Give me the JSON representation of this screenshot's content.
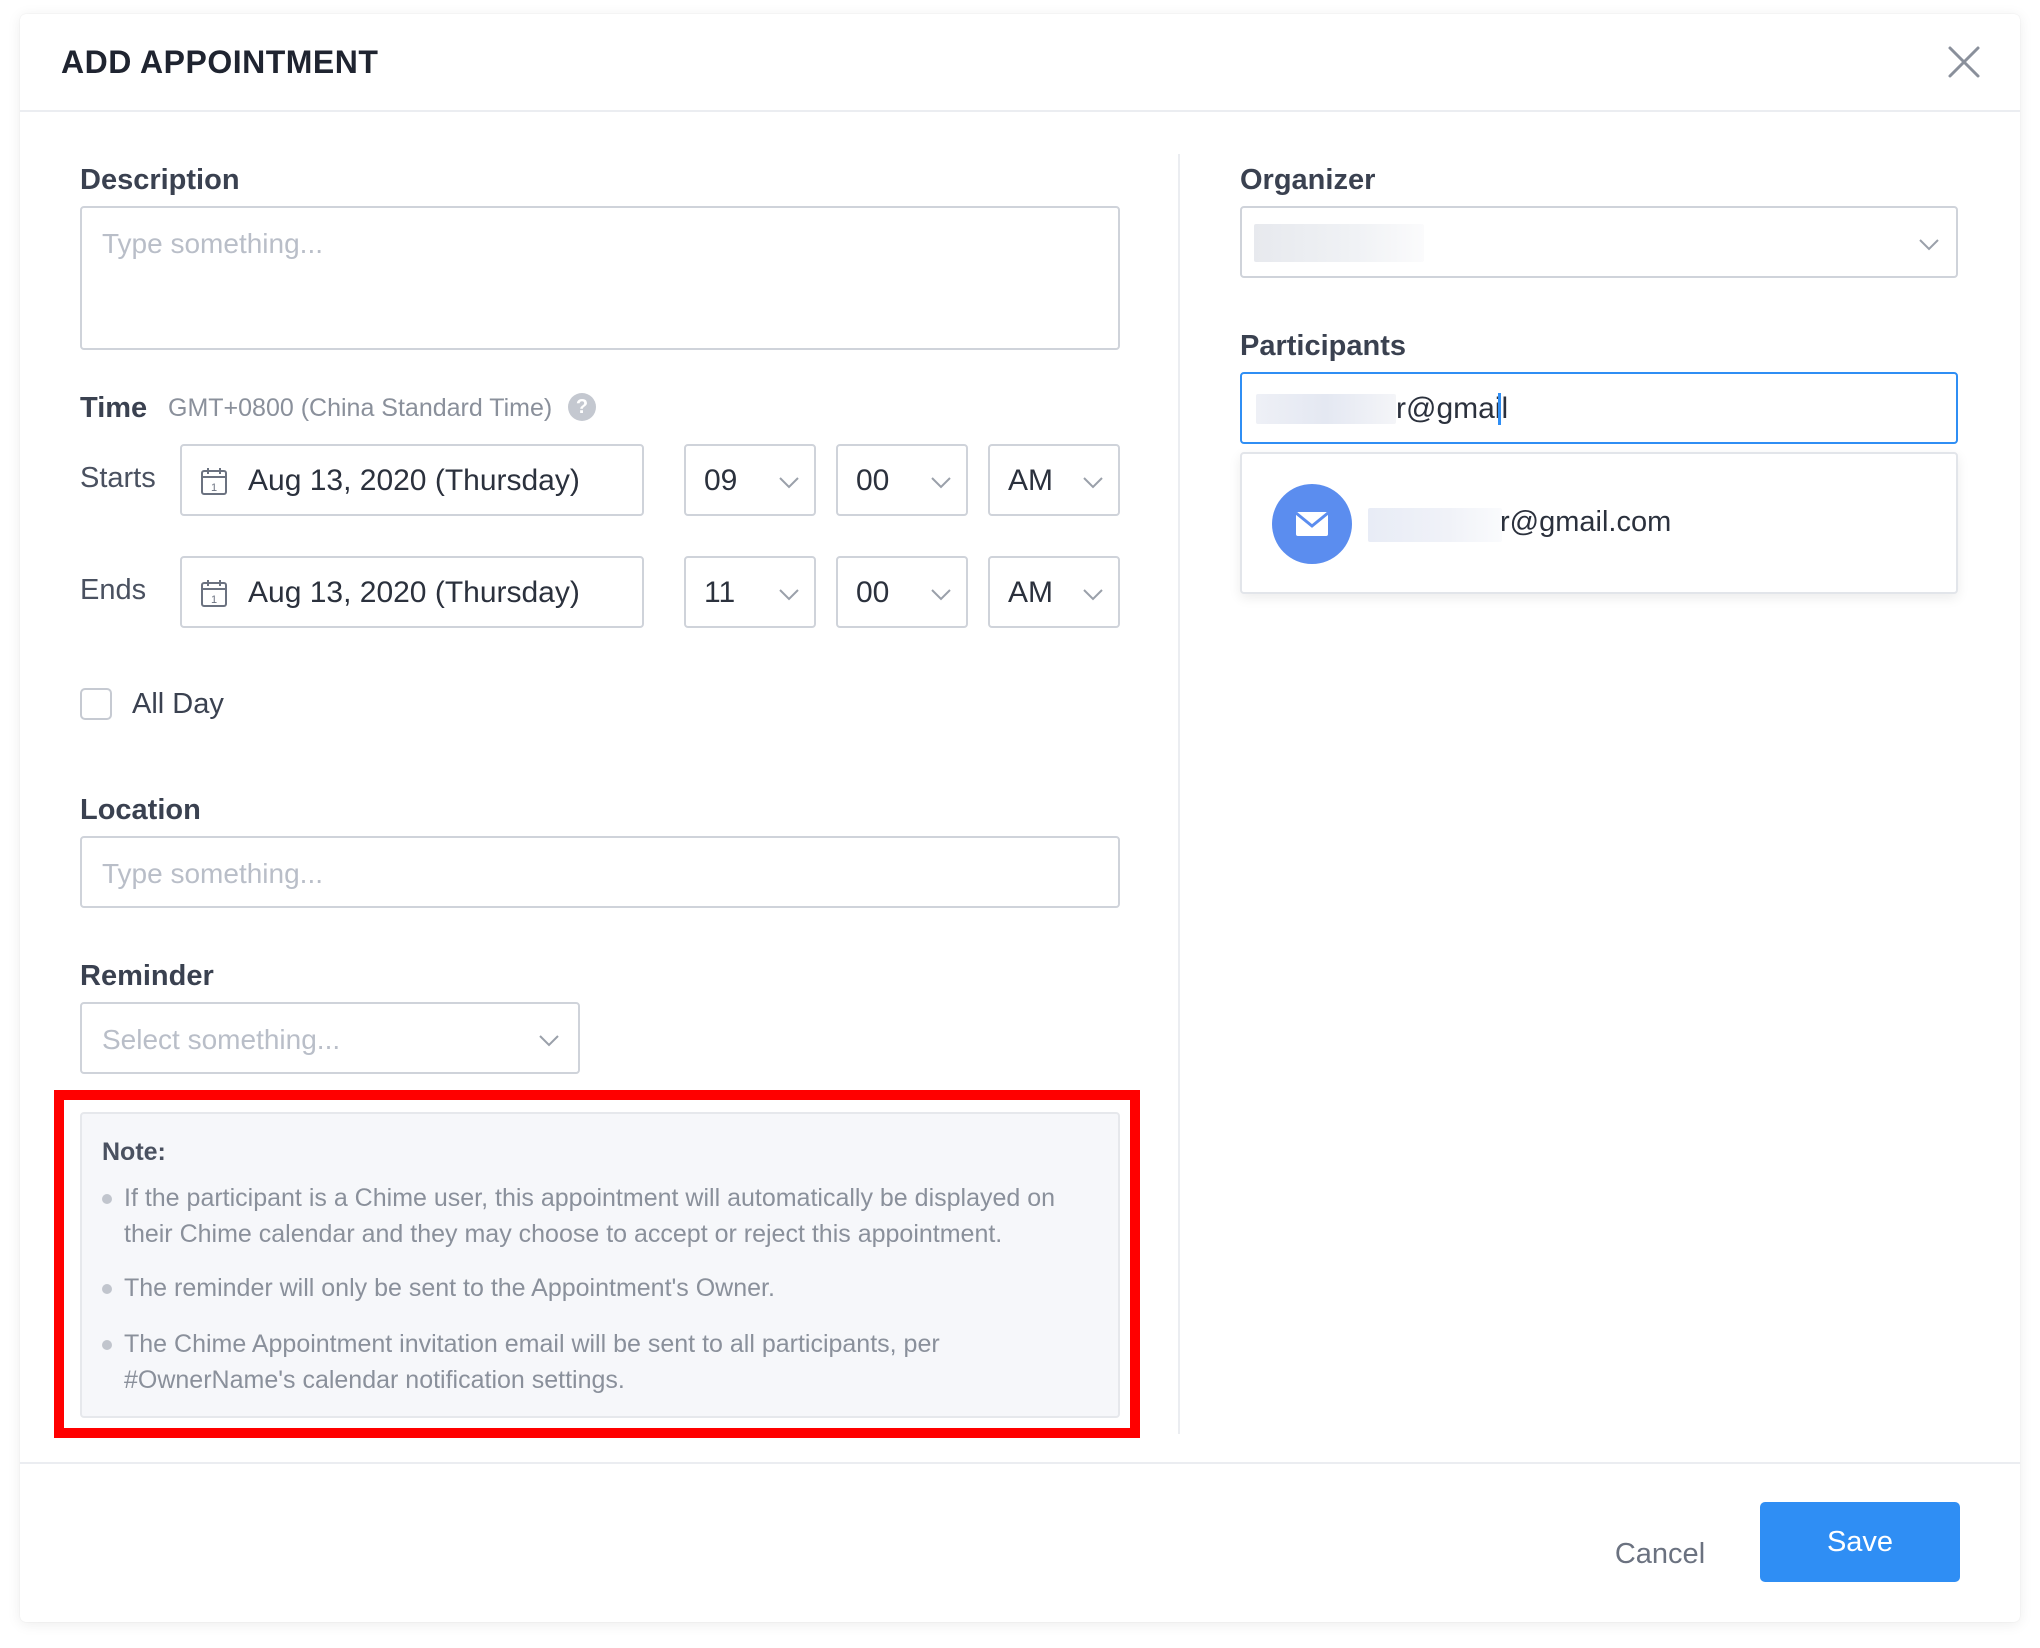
{
  "modal": {
    "title": "ADD APPOINTMENT",
    "close_icon": "close-icon"
  },
  "description": {
    "label": "Description",
    "placeholder": "Type something..."
  },
  "time": {
    "label": "Time",
    "timezone": "GMT+0800 (China Standard Time)",
    "help_icon": "?",
    "starts": {
      "label": "Starts",
      "date": "Aug 13, 2020 (Thursday)",
      "hour": "09",
      "minute": "00",
      "meridiem": "AM"
    },
    "ends": {
      "label": "Ends",
      "date": "Aug 13, 2020 (Thursday)",
      "hour": "11",
      "minute": "00",
      "meridiem": "AM"
    }
  },
  "all_day": {
    "label": "All Day",
    "checked": false
  },
  "location": {
    "label": "Location",
    "placeholder": "Type something..."
  },
  "reminder": {
    "label": "Reminder",
    "placeholder": "Select something..."
  },
  "note": {
    "title": "Note:",
    "items": [
      "If the participant is a Chime user, this appointment will automatically be displayed on their Chime calendar and they may choose to accept or reject this appointment.",
      "The reminder will only be sent to the Appointment's Owner.",
      "The Chime Appointment invitation email will be sent to all participants, per #OwnerName's calendar notification settings."
    ]
  },
  "organizer": {
    "label": "Organizer"
  },
  "participants": {
    "label": "Participants",
    "input_value_visible": "r@gmail",
    "suggestion_visible": "r@gmail.com",
    "suggestion_icon": "mail-icon"
  },
  "footer": {
    "cancel_label": "Cancel",
    "save_label": "Save"
  },
  "colors": {
    "primary": "#2f8ef4",
    "highlight": "#ff0000",
    "avatar": "#5b8def"
  }
}
